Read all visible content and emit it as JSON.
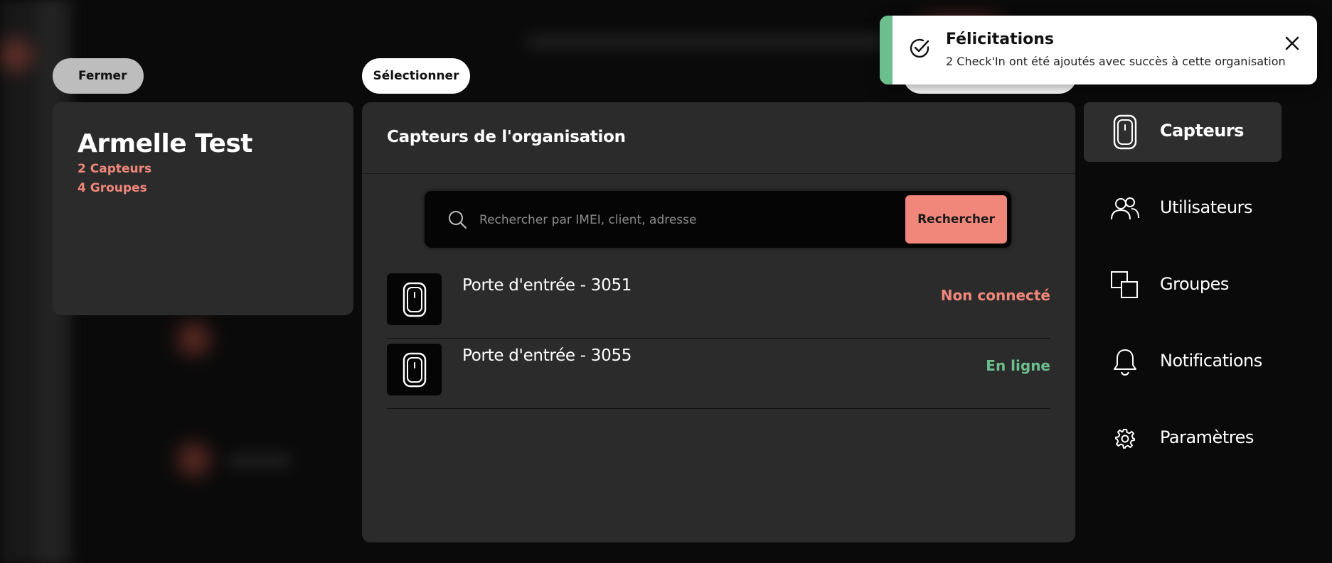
{
  "toolbar": {
    "close_label": "Fermer",
    "select_label": "Sélectionner"
  },
  "organization": {
    "name": "Armelle Test",
    "sensors_count": "2 Capteurs",
    "groups_count": "4 Groupes"
  },
  "sensors_panel": {
    "title": "Capteurs de l'organisation",
    "search_placeholder": "Rechercher par IMEI, client, adresse",
    "search_button": "Rechercher",
    "items": [
      {
        "name": "Porte d'entrée - 3051",
        "status": "Non connecté",
        "status_color": "#f1877b",
        "icon": "door-sensor-icon"
      },
      {
        "name": "Porte d'entrée - 3055",
        "status": "En ligne",
        "status_color": "#6cbf8c",
        "icon": "door-sensor-icon"
      }
    ]
  },
  "nav": {
    "items": [
      {
        "label": "Capteurs",
        "icon": "sensor-icon",
        "active": true
      },
      {
        "label": "Utilisateurs",
        "icon": "users-icon",
        "active": false
      },
      {
        "label": "Groupes",
        "icon": "groups-icon",
        "active": false
      },
      {
        "label": "Notifications",
        "icon": "bell-icon",
        "active": false
      },
      {
        "label": "Paramètres",
        "icon": "gear-icon",
        "active": false
      }
    ]
  },
  "toast": {
    "title": "Félicitations",
    "message": "2 Check'In ont été ajoutés avec succès à cette organisation",
    "accent_color": "#6cbf8c",
    "icon": "check-circle-icon"
  },
  "colors": {
    "accent": "#f1877b",
    "success": "#6cbf8c",
    "card_bg": "#2b2b2b",
    "page_bg": "#0a0a0a"
  }
}
